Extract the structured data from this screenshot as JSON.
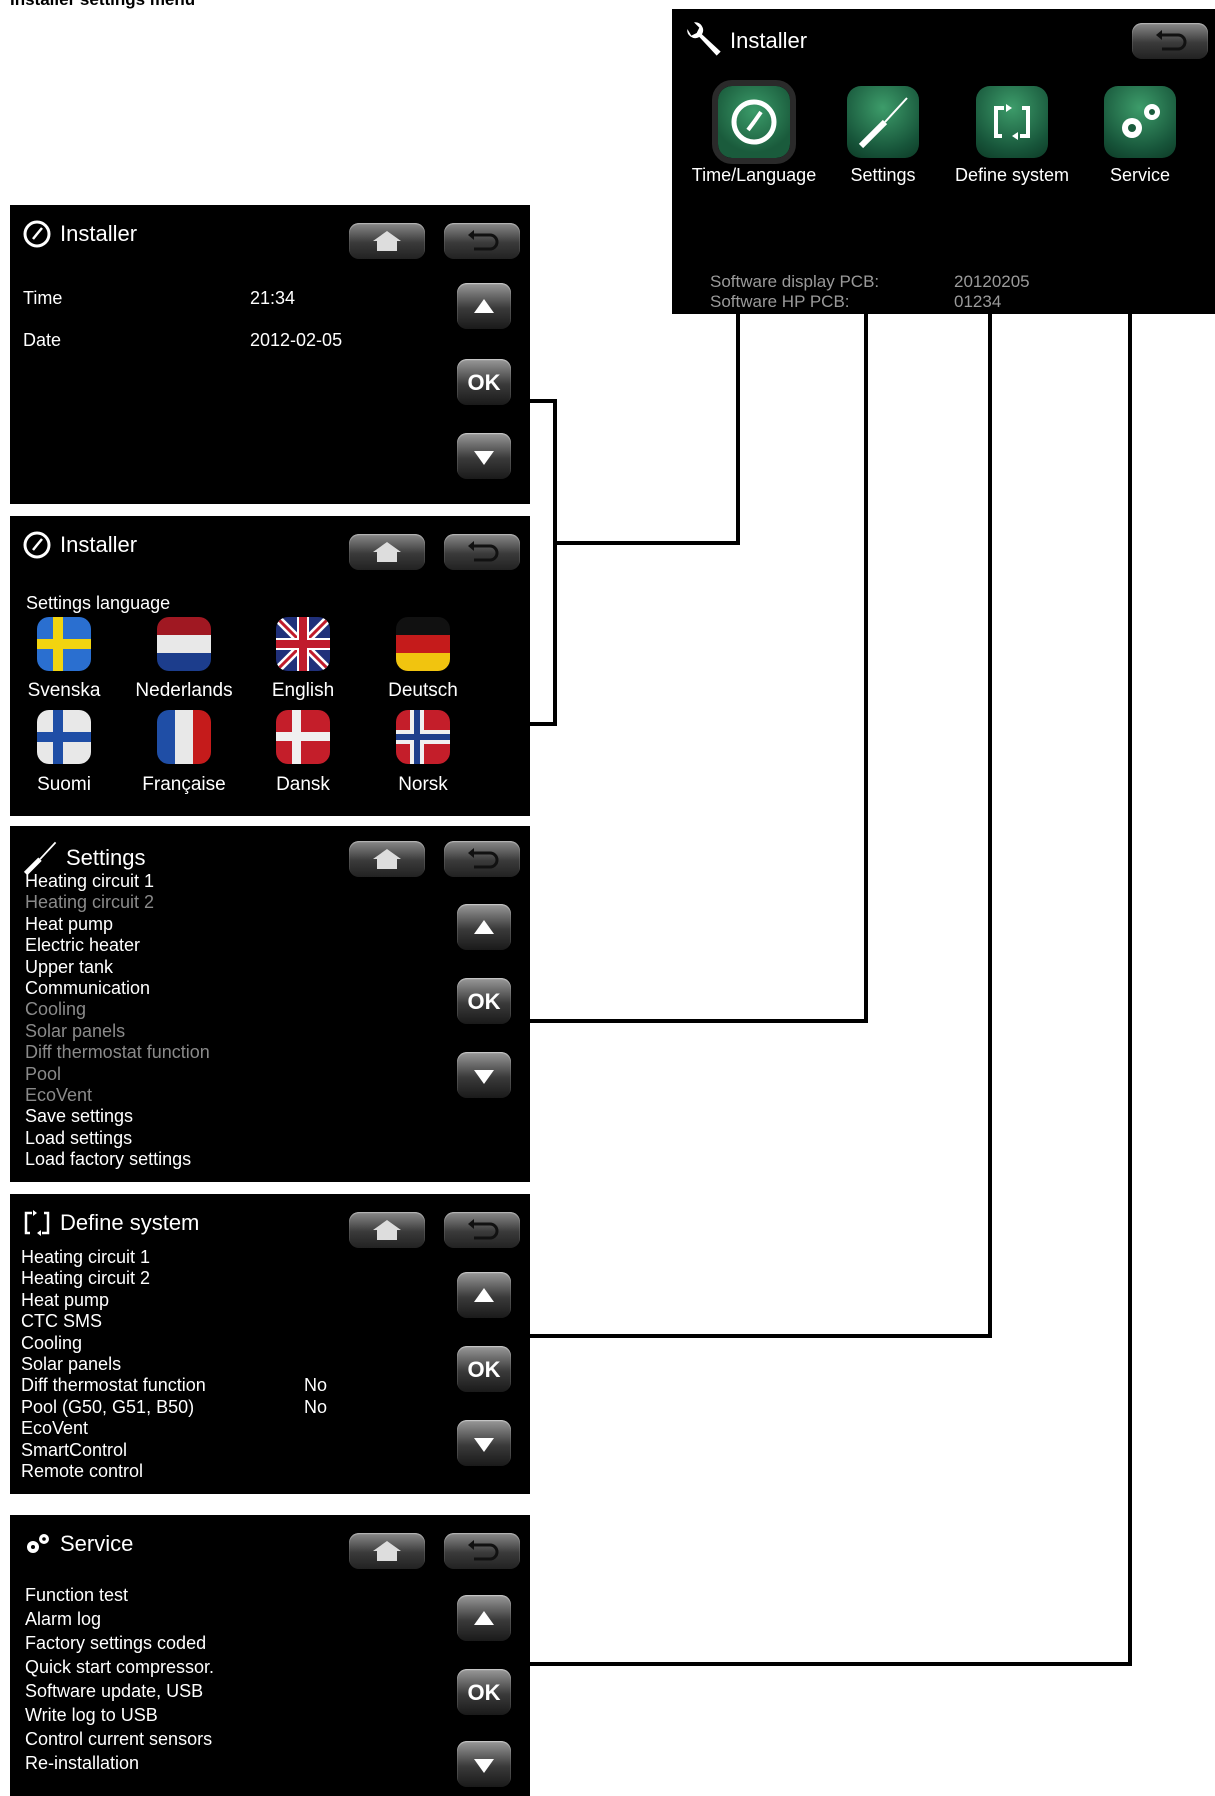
{
  "doc_title": "Installer settings menu",
  "top_panel": {
    "title": "Installer",
    "icons": [
      {
        "label": "Time/Language",
        "icon": "clock-icon"
      },
      {
        "label": "Settings",
        "icon": "screwdriver-icon"
      },
      {
        "label": "Define system",
        "icon": "define-system-icon"
      },
      {
        "label": "Service",
        "icon": "gears-icon"
      }
    ],
    "sw_display_label": "Software display PCB:",
    "sw_display_value": "20120205",
    "sw_hp_label": "Software HP PCB:",
    "sw_hp_value": "01234"
  },
  "time_panel": {
    "title": "Installer",
    "time_label": "Time",
    "time_value": "21:34",
    "date_label": "Date",
    "date_value": "2012-02-05"
  },
  "language_panel": {
    "title": "Installer",
    "heading": "Settings language",
    "languages": [
      {
        "label": "Svenska"
      },
      {
        "label": "Nederlands"
      },
      {
        "label": "English"
      },
      {
        "label": "Deutsch"
      },
      {
        "label": "Suomi"
      },
      {
        "label": "Française"
      },
      {
        "label": "Dansk"
      },
      {
        "label": "Norsk"
      }
    ]
  },
  "settings_panel": {
    "title": "Settings",
    "items": [
      {
        "label": "Heating circuit 1",
        "enabled": true
      },
      {
        "label": "Heating circuit 2",
        "enabled": false
      },
      {
        "label": "Heat pump",
        "enabled": true
      },
      {
        "label": "Electric heater",
        "enabled": true
      },
      {
        "label": "Upper tank",
        "enabled": true
      },
      {
        "label": "Communication",
        "enabled": true
      },
      {
        "label": "Cooling",
        "enabled": false
      },
      {
        "label": "Solar panels",
        "enabled": false
      },
      {
        "label": "Diff thermostat function",
        "enabled": false
      },
      {
        "label": "Pool",
        "enabled": false
      },
      {
        "label": "EcoVent",
        "enabled": false
      },
      {
        "label": "Save settings",
        "enabled": true
      },
      {
        "label": "Load settings",
        "enabled": true
      },
      {
        "label": "Load factory settings",
        "enabled": true
      }
    ]
  },
  "define_panel": {
    "title": "Define system",
    "items": [
      {
        "label": "Heating circuit 1",
        "value": ""
      },
      {
        "label": "Heating circuit 2",
        "value": ""
      },
      {
        "label": "Heat pump",
        "value": ""
      },
      {
        "label": "CTC SMS",
        "value": ""
      },
      {
        "label": "Cooling",
        "value": ""
      },
      {
        "label": "Solar panels",
        "value": ""
      },
      {
        "label": "Diff thermostat function",
        "value": "No"
      },
      {
        "label": "Pool (G50, G51, B50)",
        "value": "No"
      },
      {
        "label": "EcoVent",
        "value": ""
      },
      {
        "label": "SmartControl",
        "value": ""
      },
      {
        "label": "Remote control",
        "value": ""
      }
    ]
  },
  "service_panel": {
    "title": "Service",
    "items": [
      {
        "label": "Function test"
      },
      {
        "label": "Alarm log"
      },
      {
        "label": "Factory settings coded"
      },
      {
        "label": "Quick start compressor."
      },
      {
        "label": "Software update, USB"
      },
      {
        "label": "Write log to USB"
      },
      {
        "label": "Control current sensors"
      },
      {
        "label": "Re-installation"
      }
    ]
  },
  "buttons": {
    "ok": "OK"
  },
  "colors": {
    "panel_bg": "#000000",
    "icon_green": "#1f6b45",
    "dim_text": "#8a8a8a"
  }
}
